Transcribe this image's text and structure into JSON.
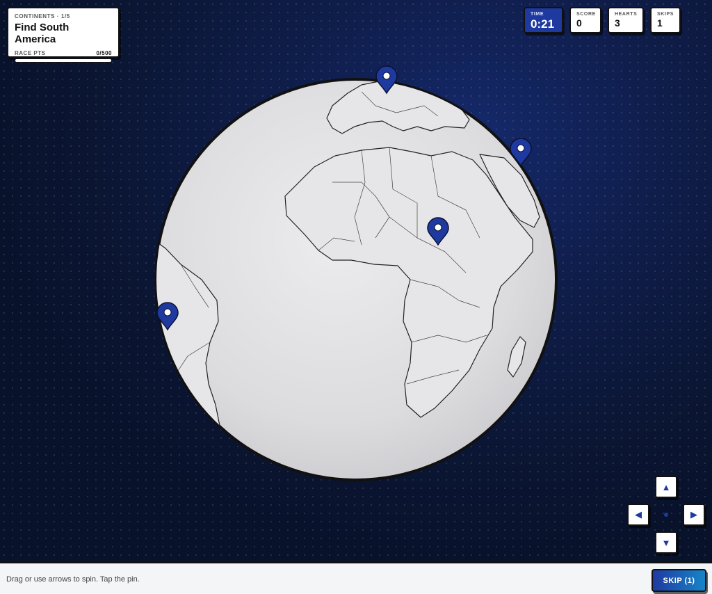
{
  "task": {
    "eyebrow": "CONTINENTS · 1/5",
    "title": "Find South America",
    "points_label": "RACE PTS",
    "points_value": "0/500",
    "progress_fraction": 0
  },
  "stats": {
    "time_label": "TIME",
    "time_value": "0:21",
    "score_label": "SCORE",
    "score_value": "0",
    "hearts_label": "HEARTS",
    "hearts_value": "3",
    "skips_label": "SKIPS",
    "skips_value": "1"
  },
  "globe": {
    "view": "Africa and Europe centered, South America on left limb",
    "pins": [
      "map-pin-europe",
      "map-pin-middle-east",
      "map-pin-central-africa",
      "map-pin-south-america"
    ]
  },
  "controls": {
    "up_icon": "▲",
    "left_icon": "◀",
    "right_icon": "▶",
    "down_icon": "▼"
  },
  "footer": {
    "hint": "Drag or use arrows to spin. Tap the pin.",
    "skip_label": "SKIP (1)"
  },
  "colors": {
    "accent": "#1e3aa0",
    "background": "#0b1634",
    "globe": "#e3e3e5"
  }
}
